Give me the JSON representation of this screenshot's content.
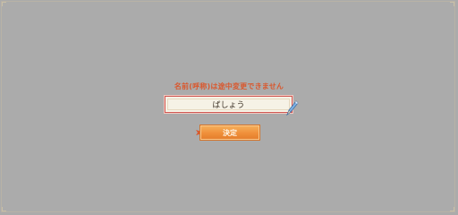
{
  "notice": "名前(呼称)は途中変更できません",
  "name_field": {
    "value": "ばしょう"
  },
  "confirm_button": {
    "label": "決定"
  },
  "icons": {
    "edit": "pencil-icon",
    "pointer": "arrow-icon"
  },
  "colors": {
    "background": "#ababab",
    "notice": "#d9582e",
    "button": "#ef8f3a",
    "field_border": "#cf5a55"
  }
}
